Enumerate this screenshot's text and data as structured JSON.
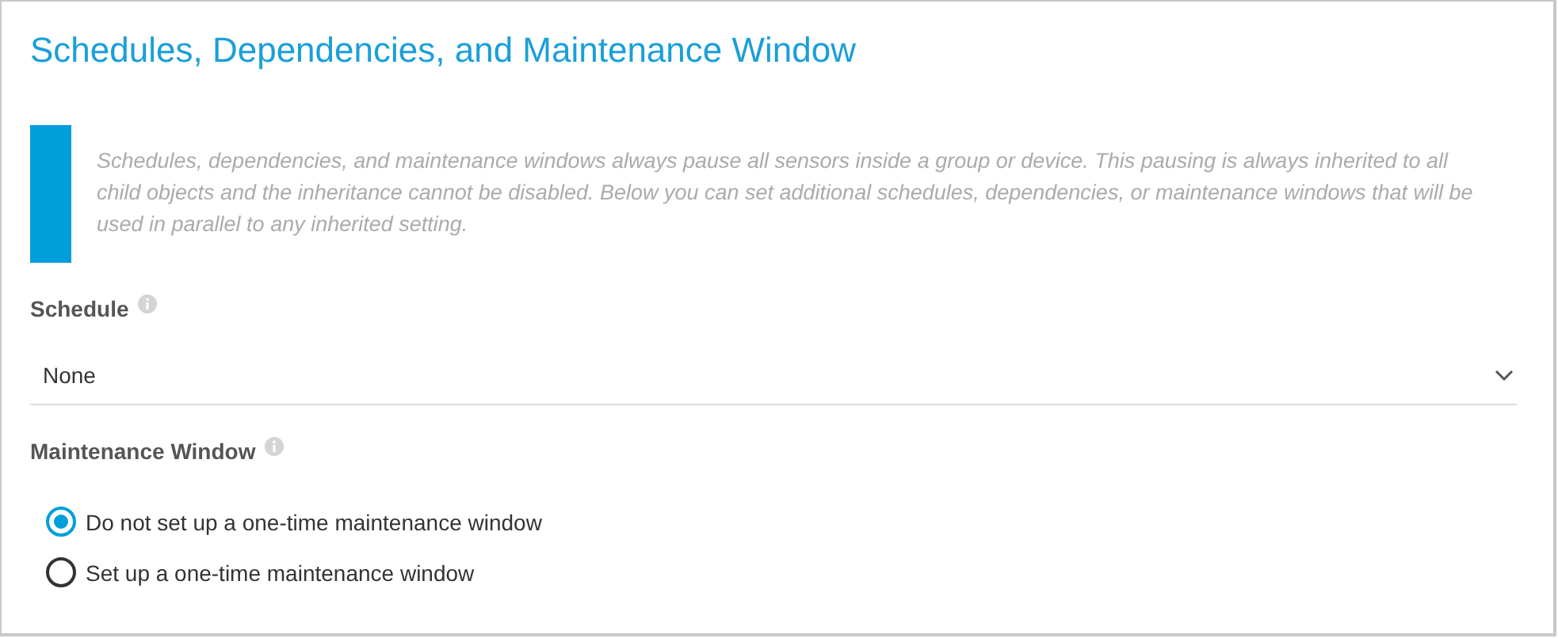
{
  "section": {
    "title": "Schedules, Dependencies, and Maintenance Window"
  },
  "info": {
    "text": "Schedules, dependencies, and maintenance windows always pause all sensors inside a group or device. This pausing is always inherited to all child objects and the inheritance cannot be disabled. Below you can set additional schedules, dependencies, or maintenance windows that will be used in parallel to any inherited setting."
  },
  "schedule": {
    "label": "Schedule",
    "value": "None"
  },
  "maintenance_window": {
    "label": "Maintenance Window",
    "options": [
      {
        "label": "Do not set up a one-time maintenance window",
        "selected": true
      },
      {
        "label": "Set up a one-time maintenance window",
        "selected": false
      }
    ]
  }
}
